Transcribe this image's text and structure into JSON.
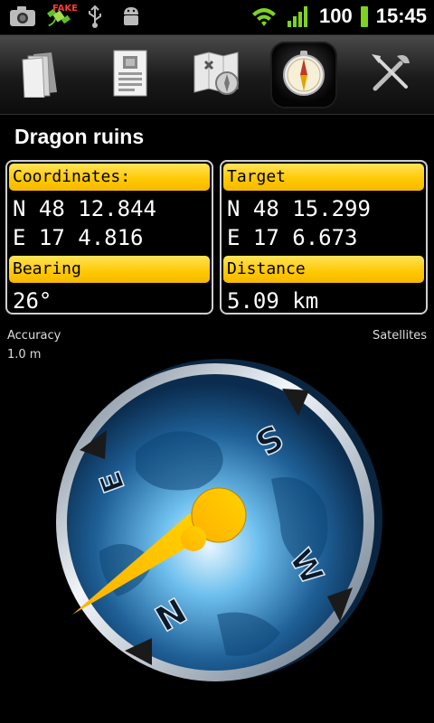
{
  "status_bar": {
    "fake_label": "FAKE",
    "battery": "100",
    "time": "15:45",
    "icons": [
      "camera-icon",
      "gps-satellite-icon",
      "usb-icon",
      "android-debug-icon",
      "wifi-icon",
      "signal-icon",
      "battery-icon"
    ]
  },
  "toolbar": {
    "items": [
      {
        "name": "files",
        "icon": "documents-icon",
        "active": false
      },
      {
        "name": "details",
        "icon": "cache-details-icon",
        "active": false
      },
      {
        "name": "map",
        "icon": "map-icon",
        "active": false
      },
      {
        "name": "compass",
        "icon": "compass-icon",
        "active": true
      },
      {
        "name": "tools",
        "icon": "tools-icon",
        "active": false
      }
    ]
  },
  "title": "Dragon ruins",
  "coordinates": {
    "label": "Coordinates:",
    "lat": "N 48 12.844",
    "lon": "E 17 4.816"
  },
  "target": {
    "label": "Target",
    "lat": "N 48 15.299",
    "lon": "E 17 6.673"
  },
  "bearing": {
    "label": "Bearing",
    "value": "26°"
  },
  "distance": {
    "label": "Distance",
    "value": "5.09 km"
  },
  "accuracy": {
    "label": "Accuracy",
    "value": "1.0 m"
  },
  "satellites": {
    "label": "Satellites"
  },
  "compass": {
    "letters": {
      "n": "N",
      "e": "E",
      "s": "S",
      "w": "W"
    },
    "colors": {
      "accent": "#ffc800",
      "dial": "#1a5a8a",
      "rim": "#dfe6ee"
    }
  }
}
